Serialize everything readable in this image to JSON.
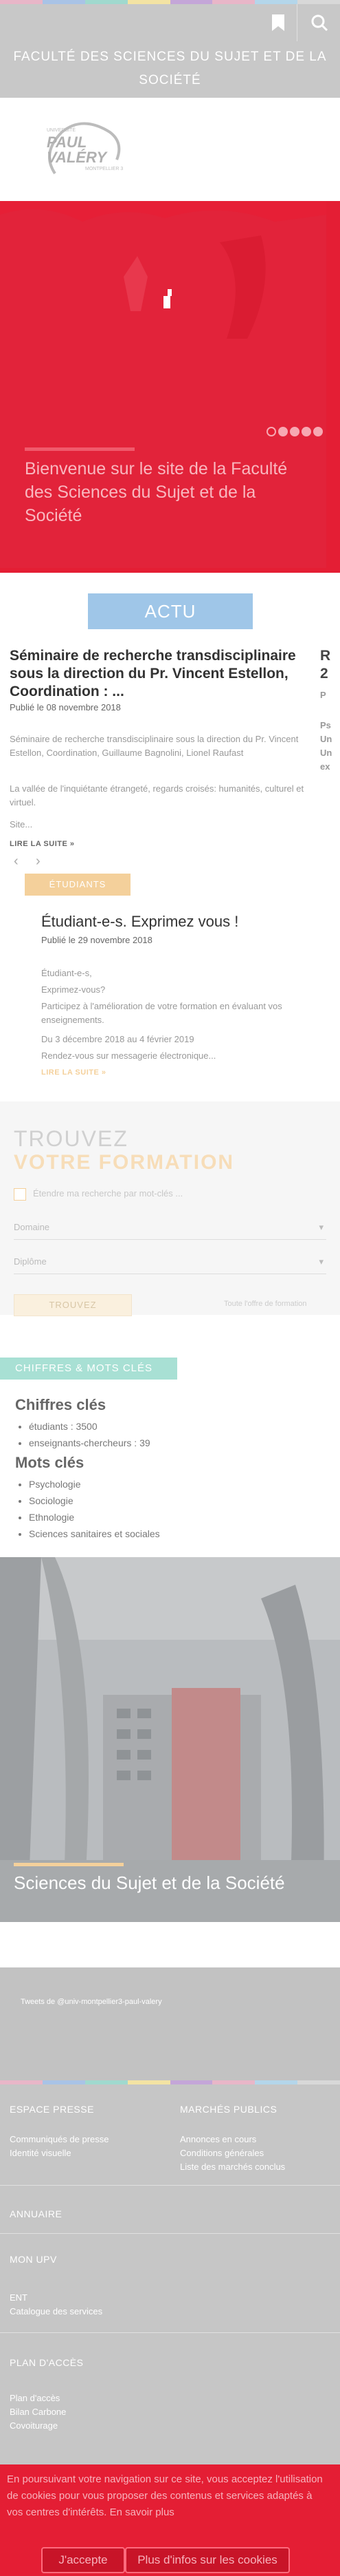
{
  "colors": {
    "strip": [
      "#e8b6c8",
      "#a9c3e6",
      "#a0d9ce",
      "#f3e3a3",
      "#c4a6d8",
      "#e8b6c8",
      "#b4d6ea",
      "#d8d8d8"
    ],
    "brand_red": "#e41e34",
    "actu_blue": "#9fc6e8",
    "accent_orange": "#f4d09b",
    "accent_teal": "#a8e0d4"
  },
  "header": {
    "faculty_name": "FACULTÉ DES SCIENCES DU SUJET ET DE LA SOCIÉTÉ",
    "bookmark_icon": "bookmark-icon",
    "search_icon": "search-icon"
  },
  "logo": {
    "line1": "UNIVERSITÉ",
    "line2": "PAUL",
    "line3": "VALÉRY",
    "line4": "MONTPELLIER 3"
  },
  "hero": {
    "title": "Bienvenue sur le site de la Faculté des Sciences du Sujet et de la Société",
    "slides": 5
  },
  "actu": {
    "button_label": "ACTU"
  },
  "news1": {
    "title": "Séminaire de recherche transdisciplinaire sous la direction du Pr. Vincent Estellon, Coordination : ...",
    "date": "Publié le 08 novembre 2018",
    "summary": "Séminaire de recherche transdisciplinaire sous la direction du Pr. Vincent Estellon, Coordination, Guillaume Bagnolini, Lionel Raufast",
    "text2": "La vallée de l'inquiétante étrangeté, regards croisés: humanités, culturel et virtuel.",
    "text3": "Site...",
    "read_more": "LIRE LA SUITE »"
  },
  "news_next": {
    "letters": [
      "R",
      "2"
    ],
    "small": [
      "P",
      "Ps",
      "Un",
      "Un",
      "ex"
    ]
  },
  "pager": {
    "prev": "‹",
    "next": "›"
  },
  "news2": {
    "tag": "ÉTUDIANTS",
    "title": "Étudiant-e-s. Exprimez vous !",
    "date": "Publié le 29 novembre 2018",
    "lines": [
      "Étudiant-e-s,",
      "Exprimez-vous?",
      "Participez à l'amélioration de votre formation en évaluant vos enseignements.",
      "Du 3 décembre 2018 au 4 février 2019",
      "Rendez-vous sur messagerie électronique..."
    ],
    "read_more": "LIRE LA SUITE »"
  },
  "trouvez": {
    "title1": "TROUVEZ",
    "title2": "VOTRE FORMATION",
    "checkbox_label": "Étendre ma recherche par mot-clés ...",
    "select1": "Domaine",
    "select2": "Diplôme",
    "button": "TROUVEZ",
    "link": "Toute l'offre de formation"
  },
  "chiffres": {
    "tag": "CHIFFRES & MOTS CLÉS",
    "heading1": "Chiffres clés",
    "items1": [
      "étudiants : 3500",
      "enseignants-chercheurs : 39"
    ],
    "heading2": "Mots clés",
    "items2": [
      "Psychologie",
      "Sociologie",
      "Ethnologie",
      "Sciences sanitaires et sociales"
    ]
  },
  "building": {
    "caption": "Sciences du Sujet et de la Société"
  },
  "footer": {
    "grey_text": "Tweets de @univ-montpellier3-paul-valery",
    "col1_head": "ESPACE PRESSE",
    "col1_links": [
      "Communiqués de presse",
      "Identité visuelle"
    ],
    "col2_head": "MARCHÉS PUBLICS",
    "col2_links": [
      "Annonces en cours",
      "Conditions générales",
      "Liste des marchés conclus"
    ],
    "annuaire": "ANNUAIRE",
    "mon_upv": "MON UPV",
    "mon_upv_links": [
      "ENT",
      "Catalogue des services"
    ],
    "plan": "PLAN D'ACCÈS",
    "plan_links": [
      "Plan d'accès",
      "Bilan Carbone",
      "Covoiturage"
    ]
  },
  "cookie": {
    "text": "En poursuivant votre navigation sur ce site, vous acceptez l'utilisation de cookies pour vous proposer des contenus et services adaptés à vos centres d'intérêts. En savoir plus",
    "accept": "J'accepte",
    "more": "Plus d'infos sur les cookies"
  }
}
